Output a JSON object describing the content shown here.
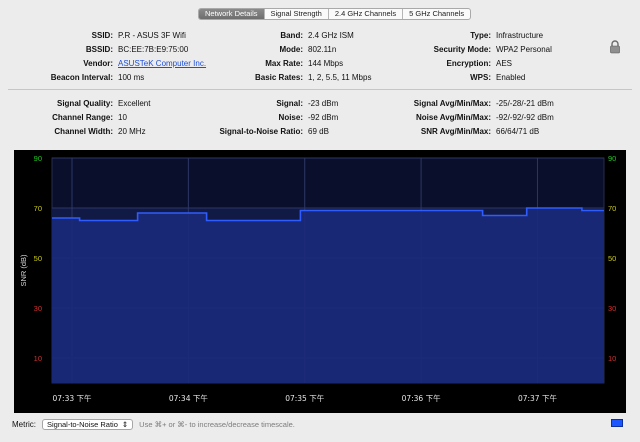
{
  "tabs": [
    "Network Details",
    "Signal Strength",
    "2.4 GHz Channels",
    "5 GHz Channels"
  ],
  "details": {
    "col1": [
      {
        "label": "SSID:",
        "value": "P.R - ASUS 3F Wifi"
      },
      {
        "label": "BSSID:",
        "value": "BC:EE:7B:E9:75:00"
      },
      {
        "label": "Vendor:",
        "value": "ASUSTeK Computer Inc."
      },
      {
        "label": "Beacon Interval:",
        "value": "100 ms"
      }
    ],
    "col2": [
      {
        "label": "Band:",
        "value": "2.4 GHz ISM"
      },
      {
        "label": "Mode:",
        "value": "802.11n"
      },
      {
        "label": "Max Rate:",
        "value": "144 Mbps"
      },
      {
        "label": "Basic Rates:",
        "value": "1, 2, 5.5, 11 Mbps"
      }
    ],
    "col3": [
      {
        "label": "Type:",
        "value": "Infrastructure"
      },
      {
        "label": "Security Mode:",
        "value": "WPA2 Personal"
      },
      {
        "label": "Encryption:",
        "value": "AES"
      },
      {
        "label": "WPS:",
        "value": "Enabled"
      }
    ]
  },
  "signal": {
    "col1": [
      {
        "label": "Signal Quality:",
        "value": "Excellent"
      },
      {
        "label": "Channel Range:",
        "value": "10"
      },
      {
        "label": "Channel Width:",
        "value": "20 MHz"
      }
    ],
    "col2": [
      {
        "label": "Signal:",
        "value": "-23 dBm"
      },
      {
        "label": "Noise:",
        "value": "-92 dBm"
      },
      {
        "label": "Signal-to-Noise Ratio:",
        "value": "69 dB"
      }
    ],
    "col3": [
      {
        "label": "Signal Avg/Min/Max:",
        "value": "-25/-28/-21 dBm"
      },
      {
        "label": "Noise Avg/Min/Max:",
        "value": "-92/-92/-92 dBm"
      },
      {
        "label": "SNR Avg/Min/Max:",
        "value": "66/64/71 dB"
      }
    ]
  },
  "footer": {
    "metric_label": "Metric:",
    "metric_value": "Signal-to-Noise Ratio",
    "hint": "Use ⌘+ or ⌘- to increase/decrease timescale."
  },
  "icons": {
    "lock": "lock-icon",
    "select_arrow": "updown-arrow-icon"
  },
  "colors": {
    "series": "#2f5cff",
    "background": "#000000",
    "fill": "#1b2a7a"
  },
  "chart_data": {
    "type": "area",
    "ylabel": "SNR (dB)",
    "ylim": [
      0,
      90
    ],
    "yticks": [
      {
        "value": 90,
        "color": "#22c322"
      },
      {
        "value": 70,
        "color": "#c9c916"
      },
      {
        "value": 50,
        "color": "#c9c916"
      },
      {
        "value": 30,
        "color": "#d23030"
      },
      {
        "value": 10,
        "color": "#d23030"
      }
    ],
    "xlabels": [
      "07:33 下午",
      "07:34 下午",
      "07:35 下午",
      "07:36 下午",
      "07:37 下午"
    ],
    "xrange": [
      0,
      10
    ],
    "series": [
      {
        "x": [
          0,
          0.5,
          0.5,
          1.55,
          1.55,
          2.8,
          2.8,
          4.5,
          4.5,
          6.7,
          6.7,
          7.8,
          7.8,
          8.6,
          8.6,
          9.6,
          9.6,
          10
        ],
        "values": [
          66,
          66,
          65,
          65,
          68,
          68,
          65,
          65,
          69,
          69,
          69,
          69,
          67,
          67,
          70,
          70,
          69,
          69
        ]
      }
    ]
  }
}
